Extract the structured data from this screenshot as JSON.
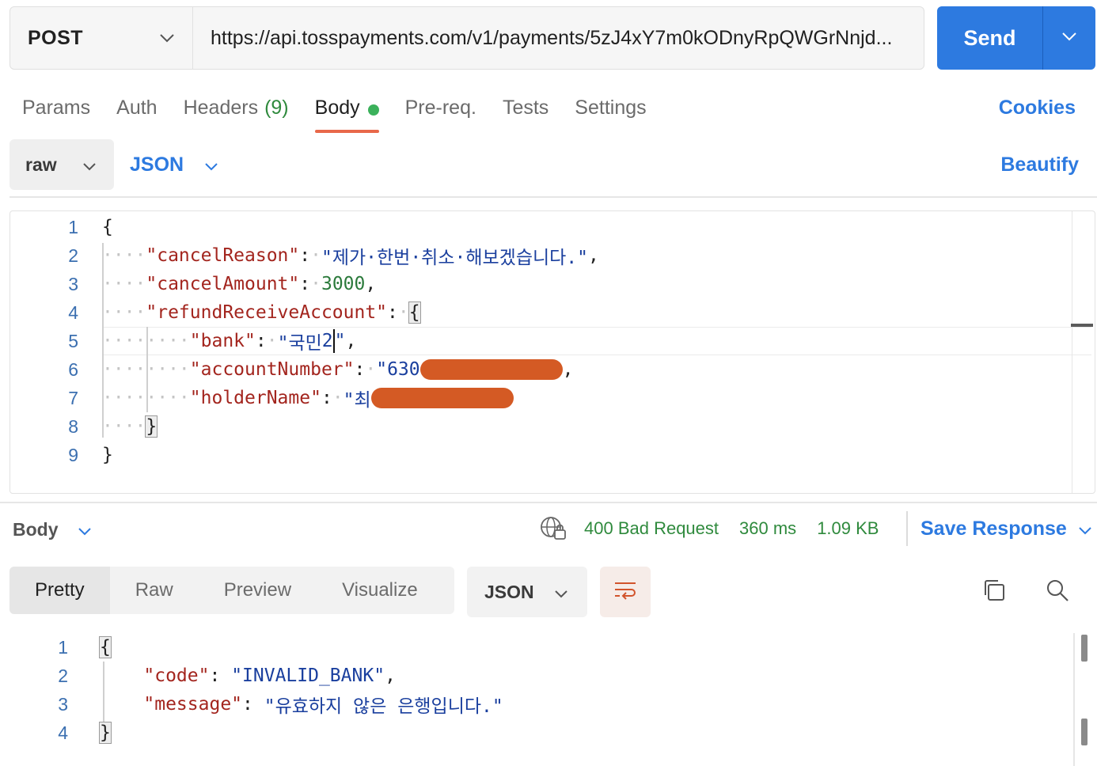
{
  "request": {
    "method": "POST",
    "url": "https://api.tosspayments.com/v1/payments/5zJ4xY7m0kODnyRpQWGrNnjd...",
    "send_label": "Send"
  },
  "request_tabs": {
    "params": "Params",
    "auth": "Auth",
    "headers": "Headers",
    "headers_count": "(9)",
    "body": "Body",
    "prereq": "Pre-req.",
    "tests": "Tests",
    "settings": "Settings",
    "cookies": "Cookies"
  },
  "body_options": {
    "mode": "raw",
    "language": "JSON",
    "beautify": "Beautify"
  },
  "request_body": {
    "line_numbers": [
      "1",
      "2",
      "3",
      "4",
      "5",
      "6",
      "7",
      "8",
      "9"
    ],
    "l1": "{",
    "l2_key": "\"cancelReason\"",
    "l2_val": "\"제가·한번·취소·해보겠습니다.\"",
    "l3_key": "\"cancelAmount\"",
    "l3_val": "3000",
    "l4_key": "\"refundReceiveAccount\"",
    "l5_key": "\"bank\"",
    "l5_val_a": "\"국민",
    "l5_val_b": "2",
    "l5_val_c": "\"",
    "l6_key": "\"accountNumber\"",
    "l6_val": "\"630",
    "l7_key": "\"holderName\"",
    "l7_val": "\"최",
    "l8": "}",
    "l9": "}"
  },
  "response_header": {
    "body_label": "Body",
    "status": "400 Bad Request",
    "time": "360 ms",
    "size": "1.09 KB",
    "save_response": "Save Response"
  },
  "response_view": {
    "tabs": [
      "Pretty",
      "Raw",
      "Preview",
      "Visualize"
    ],
    "active_tab": "Pretty",
    "format": "JSON"
  },
  "response_body": {
    "line_numbers": [
      "1",
      "2",
      "3",
      "4"
    ],
    "l1": "{",
    "l2_key": "\"code\"",
    "l2_val": "\"INVALID_BANK\"",
    "l3_key": "\"message\"",
    "l3_val": "\"유효하지 않은 은행입니다.\"",
    "l4": "}"
  },
  "colors": {
    "accent": "#2d7ae0",
    "status_success_text": "#2f8a3d",
    "tab_indicator": "#e8684a",
    "redaction": "#d45a24",
    "json_key": "#a3251e",
    "json_string": "#1a3f9e",
    "json_number": "#2b7a3b"
  }
}
